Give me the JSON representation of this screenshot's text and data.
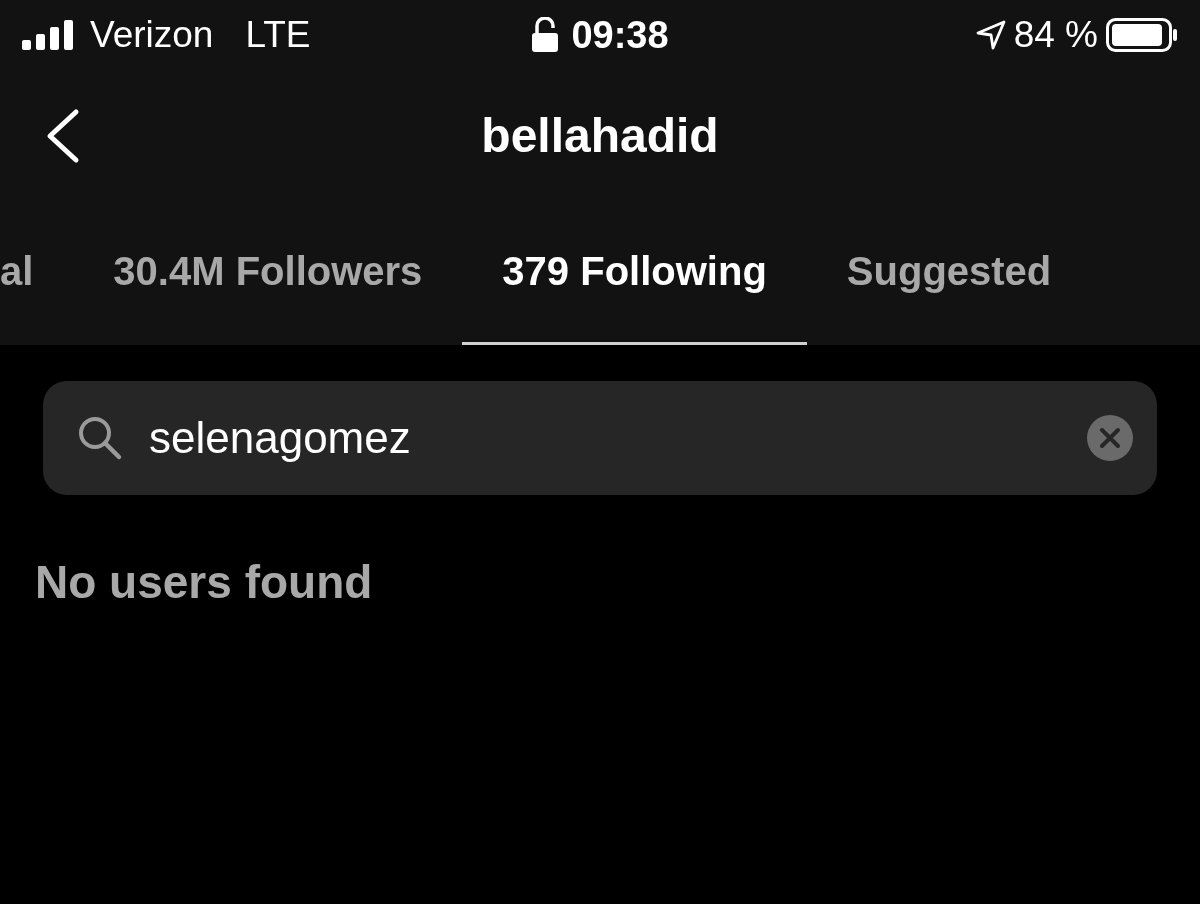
{
  "status_bar": {
    "carrier": "Verizon",
    "network": "LTE",
    "time": "09:38",
    "battery": "84 %"
  },
  "header": {
    "title": "bellahadid"
  },
  "tabs": [
    {
      "label": "al",
      "selected": false
    },
    {
      "label": "30.4M Followers",
      "selected": false
    },
    {
      "label": "379 Following",
      "selected": true
    },
    {
      "label": "Suggested",
      "selected": false
    }
  ],
  "search": {
    "value": "selenagomez"
  },
  "message": "No users found"
}
